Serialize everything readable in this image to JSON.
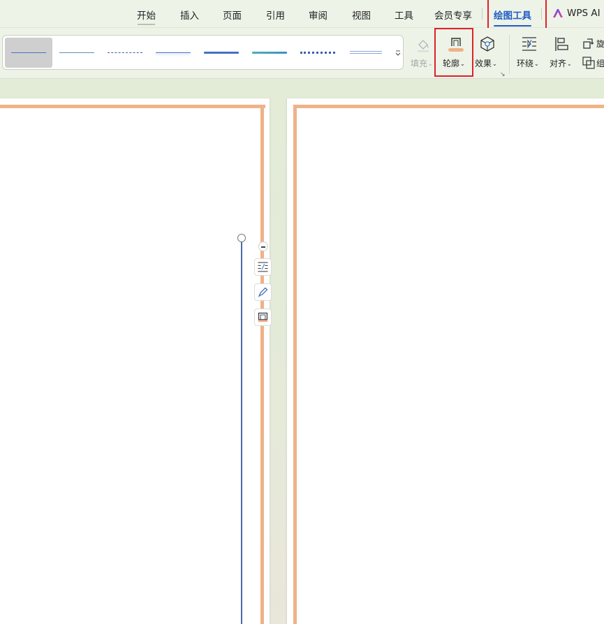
{
  "menu": {
    "tabs": [
      "开始",
      "插入",
      "页面",
      "引用",
      "审阅",
      "视图",
      "工具",
      "会员专享"
    ],
    "active_tab": "绘图工具",
    "wps_ai": "WPS AI"
  },
  "ribbon": {
    "gallery": {
      "styles": [
        {
          "name": "thin-blue-selected",
          "color": "#4472c4",
          "kind": "solid-thin"
        },
        {
          "name": "thin-teal",
          "color": "#5b8fb5",
          "kind": "solid-thin"
        },
        {
          "name": "dashed",
          "color": "#3b5ea8",
          "kind": "dashed"
        },
        {
          "name": "thin-glow",
          "color": "#4472c4",
          "kind": "solid-glow"
        },
        {
          "name": "thick-blue",
          "color": "#4472c4",
          "kind": "solid-thick"
        },
        {
          "name": "thick-teal",
          "color": "#4bb0b5",
          "kind": "solid-thick-gradient"
        },
        {
          "name": "dotted",
          "color": "#3b5ea8",
          "kind": "dotted"
        },
        {
          "name": "double",
          "color": "#8ea3d8",
          "kind": "double"
        }
      ]
    },
    "fill_label": "填充",
    "outline_label": "轮廓",
    "outline_color": "#f0b287",
    "effect_label": "效果",
    "wrap_label": "环绕",
    "align_label": "对齐",
    "rotate_label": "旋",
    "group_label": "组"
  },
  "colors": {
    "accent_blue": "#1f5cc6",
    "page_border": "#f0b287",
    "highlight_red": "#e0202a",
    "line_blue": "#4a6aa8"
  }
}
